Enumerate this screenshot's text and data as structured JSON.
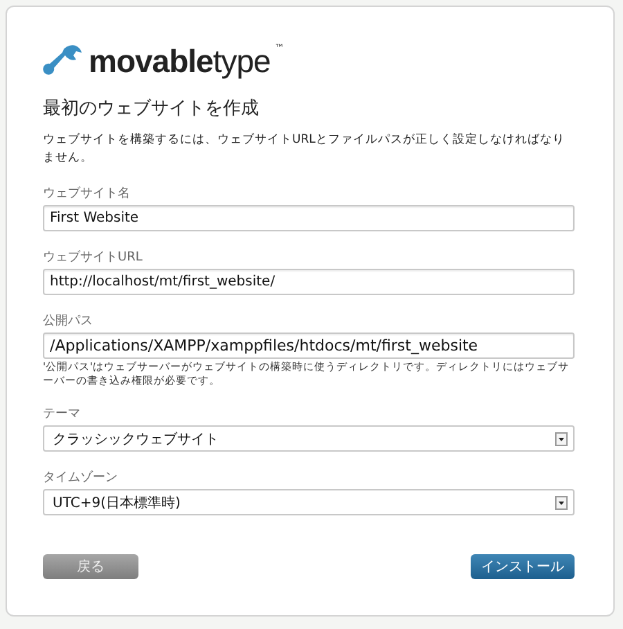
{
  "logo": {
    "text": "**movable**type",
    "mark": "™"
  },
  "title": "最初のウェブサイトを作成",
  "description": "ウェブサイトを構築するには、ウェブサイトURLとファイルパスが正しく設定しなければなりません。",
  "fields": [
    {
      "kind": "text",
      "label": "ウェブサイト名",
      "value": "First Website"
    },
    {
      "kind": "text",
      "label": "ウェブサイトURL",
      "value": "http://localhost/mt/first_website/"
    },
    {
      "kind": "text",
      "label": "公開パス",
      "value": "/Applications/XAMPP/xamppfiles/htdocs/mt/first_website",
      "hint": "'公開パス'はウェブサーバーがウェブサイトの構築時に使うディレクトリです。ディレクトリにはウェブサーバーの書き込み権限が必要です。"
    },
    {
      "kind": "select",
      "label": "テーマ",
      "value": "クラッシックウェブサイト"
    },
    {
      "kind": "select",
      "label": "タイムゾーン",
      "value": "UTC+9(日本標準時)"
    }
  ],
  "buttons": [
    {
      "kind": "back",
      "label": "戻る"
    },
    {
      "kind": "primary",
      "label": "インストール"
    }
  ]
}
